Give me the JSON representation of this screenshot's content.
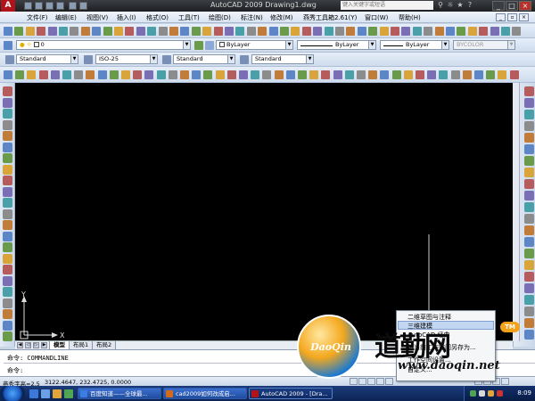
{
  "window": {
    "title": "AutoCAD 2009  Drawing1.dwg",
    "search_placeholder": "键入关键字或短语"
  },
  "menu": [
    "文件(F)",
    "编辑(E)",
    "视图(V)",
    "插入(I)",
    "格式(O)",
    "工具(T)",
    "绘图(D)",
    "标注(N)",
    "修改(M)",
    "燕秀工具箱2.61(Y)",
    "窗口(W)",
    "帮助(H)"
  ],
  "layers": {
    "layer_value": "0",
    "color": "ByLayer",
    "linetype": "ByLayer",
    "lineweight": "ByLayer",
    "plotstyle": "BYCOLOR"
  },
  "styles": {
    "text_style": "Standard",
    "dim_style": "ISO-25",
    "table_style": "Standard",
    "mleader_style": "Standard"
  },
  "ucs": {
    "y_label": "Y",
    "x_label": "X"
  },
  "tabs": [
    "模型",
    "布局1",
    "布局2"
  ],
  "command": {
    "history": "命令: COMMANDLINE",
    "prompt": "命令:"
  },
  "status": {
    "font_height": "燕秀字高=2.5",
    "coords": "3122.4647, 232.4725, 0.0000"
  },
  "context_menu": {
    "items": [
      "二维草图与注释",
      "三维建模",
      "AutoCAD 经典",
      "将当前工作空间另存为...",
      "工作空间设置...",
      "自定义..."
    ]
  },
  "taskbar": {
    "items": [
      {
        "label": "百度知道——全球最...",
        "color": "#3b7de0"
      },
      {
        "label": "cad2009如何改成启...",
        "color": "#d36b1c"
      },
      {
        "label": "AutoCAD 2009 - [Dra...",
        "color": "#b1131a"
      }
    ],
    "clock": "8:09"
  },
  "watermark": {
    "circle_text": "DaoQin",
    "brand": "道勤网",
    "url": "www.daoqin.net",
    "badge": "TM"
  }
}
